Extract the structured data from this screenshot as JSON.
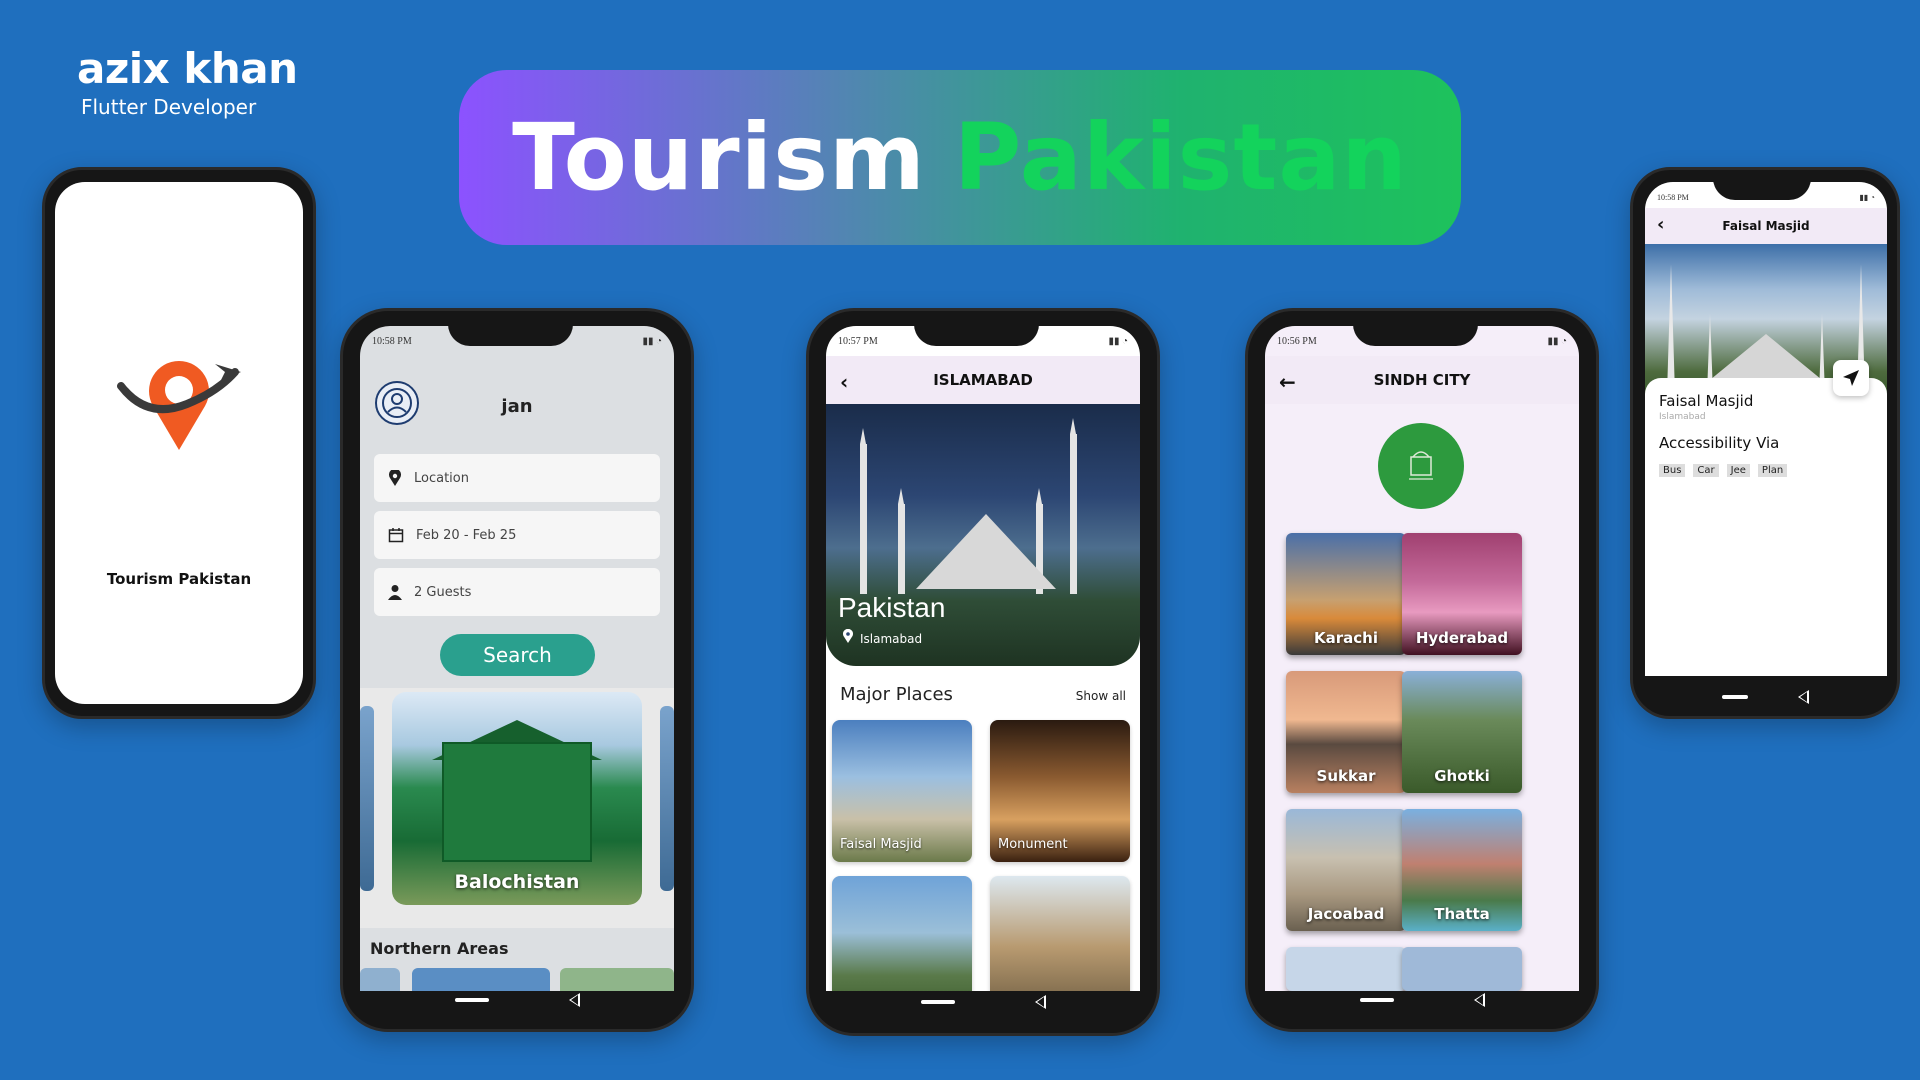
{
  "brand": {
    "name": "azix khan",
    "role": "Flutter Developer"
  },
  "banner": {
    "word1": "Tourism",
    "word2": "Pakistan"
  },
  "splash": {
    "title": "Tourism Pakistan"
  },
  "home": {
    "status_time": "10:58 PM",
    "user_name": "jan",
    "location_placeholder": "Location",
    "dates": "Feb 20 - Feb 25",
    "guests": "2 Guests",
    "search_label": "Search",
    "featured_label": "Balochistan",
    "section_title": "Northern Areas"
  },
  "islamabad": {
    "status_time": "10:57 PM",
    "header": "ISLAMABAD",
    "hero_title": "Pakistan",
    "hero_location": "Islamabad",
    "section_title": "Major Places",
    "show_all": "Show all",
    "places": [
      "Faisal Masjid",
      "Monument"
    ]
  },
  "sindh": {
    "status_time": "10:56 PM",
    "header": "SINDH CITY",
    "cities": [
      "Karachi",
      "Hyderabad",
      "Sukkar",
      "Ghotki",
      "Jacoabad",
      "Thatta"
    ]
  },
  "detail": {
    "status_time": "10:58 PM",
    "header": "Faisal Masjid",
    "title": "Faisal Masjid",
    "subtitle": "Islamabad",
    "accessibility": "Accessibility Via",
    "modes": [
      "Bus",
      "Car",
      "Jee",
      "Plan"
    ]
  },
  "colors": {
    "background": "#1f6fbe",
    "accent_green": "#13d35c",
    "button_teal": "#2aa08e",
    "header_lavender": "#f2eaf6"
  }
}
